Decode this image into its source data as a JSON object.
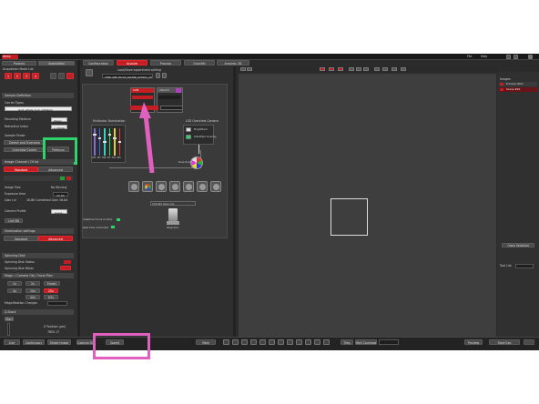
{
  "title_bar": {
    "brand": "ZEISS",
    "menu_file": "File",
    "menu_help": "Help"
  },
  "left_panel": {
    "tab_projects": "Projects",
    "tab_acquisition": "Acquisition",
    "acq_mode_label": "Acquisition Mode List",
    "mode_buttons": [
      "1",
      "2",
      "3",
      "4"
    ],
    "sample_def_header": "Sample Definition",
    "carrier_label": "Carrier Types",
    "carrier_value": "Ibidi µPlate 4um (96Well)",
    "mounting_label": "Mounting Medium",
    "mounting_value": "Water",
    "refractive_label": "Refractive Index",
    "refractive_value": "1.33000",
    "sample_finder_label": "Sample Finder",
    "detect_overview": "Detect and Overview",
    "overview_carrier": "Overview Carrier",
    "prefocus": "Prefocus",
    "image_channel_header": "Image Channel / Of Int",
    "tab_standard": "Standard",
    "tab_advanced": "Advanced",
    "image_size_label": "Image Size",
    "image_size_value": "No Binning",
    "exposure_label": "Exposure time",
    "exposure_value": "10.00",
    "gain_label": "Gain Lvl",
    "gain_value": "16-Bit Combined Gain 16-bit",
    "camera_profile_label": "Camera Profile",
    "camera_profile_value": "Cam1",
    "live_btn": "Live Bit",
    "illumination_header": "Illumination settings",
    "ill_standard": "Standard",
    "ill_advanced": "Advanced",
    "spinning_header": "Spinning Disk",
    "spinning_status": "Spinning Disk Status",
    "spinning_motor": "Spinning Disk Motor",
    "magn_header": "Magn. / Camera Obj / Focal Plan",
    "mag_buttons": [
      "1x",
      "2x",
      "Empty",
      "4x",
      "10x",
      "20x",
      "40x",
      "63x"
    ],
    "mag_changer": "Magnification Changer",
    "z_stack_header": "Z-Stack",
    "z_btn": "Start",
    "z_pos_label": "Z Position (µm)",
    "z_pos_value": "7805.17"
  },
  "top_tabs": [
    "Configuration",
    "Acquire",
    "Process",
    "Quantify",
    "Analysis 3D"
  ],
  "experiment_name": "Load/Save experiment setting",
  "experiment_value": "TIME LINE 20x03_SI0488_GFP201_03AUG.czexp",
  "workflow": {
    "multicolor_label": "Multicolor Illumination",
    "laser_labels": [
      "405",
      "445",
      "488",
      "515",
      "561",
      "640"
    ],
    "led_label": "LED Overview Camera",
    "led_values": [
      "Brightfield",
      "Widefield Overlay"
    ],
    "channels": [
      "SUM",
      "ANALYZ"
    ],
    "optic_label": "Dual Zoom",
    "prism_label": "CSU-W1 Spinning",
    "objective_label": "Objective",
    "adaptive_focus": "Adaptive Focus Control",
    "realtime": "Real time controlled",
    "camera_label": "Camera"
  },
  "right_panel": {
    "images_header": "Images",
    "item1": "Preview 0001",
    "item2": "Scene #10",
    "open_btn": "Open Selected",
    "tool_list": "Tool List"
  },
  "bottom_bar": {
    "live": "Live",
    "continuous": "Continuous",
    "snap": "Single Image",
    "capture": "Capture Dir",
    "speed": "Speed",
    "mark": "Mark",
    "tiles": "Tiles",
    "well": "Well Coverage",
    "preview": "Preview",
    "start": "Start Exp"
  },
  "accent_colors": {
    "red": "#c41e24",
    "highlight_green": "#2ed36b",
    "highlight_pink": "#e060c0"
  }
}
